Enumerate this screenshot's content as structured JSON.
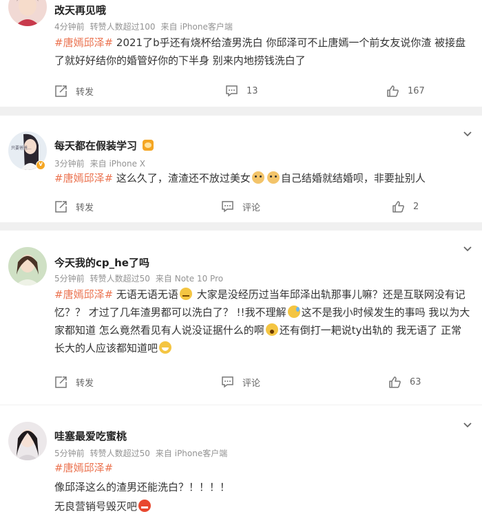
{
  "posts": [
    {
      "name": "改天再见哦",
      "time": "4分钟前",
      "reposts_note": "转赞人数超过100",
      "source": "来自 iPhone客户端",
      "tag": "#唐嫣邱泽#",
      "body": " 2021了b乎还有烧杯给渣男洗白 你邱泽可不止唐嫣一个前女友说你渣 被接盘了就好好结你的婚管好你的下半身 别来内地捞钱洗白了",
      "repost_label": "转发",
      "comment_label": "13",
      "like_label": "167"
    },
    {
      "name": "每天都在假装学习",
      "time": "3分钟前",
      "source": "来自 iPhone X",
      "tag": "#唐嫣邱泽#",
      "body_1": " 这么久了，渣渣还不放过美女",
      "body_2": "自己结婚就结婚呗，非要扯别人",
      "repost_label": "转发",
      "comment_label": "评论",
      "like_label": "2",
      "avatar_text": "只要爸爸..."
    },
    {
      "name": "今天我的cp_he了吗",
      "time": "5分钟前",
      "reposts_note": "转赞人数超过50",
      "source": "来自 Note 10 Pro",
      "tag": "#唐嫣邱泽#",
      "body_1": " 无语无语无语",
      "body_2": " 大家是没经历过当年邱泽出轨那事儿嘛？还是互联网没有记忆？？ 才过了几年渣男都可以洗白了？ !!我不理解",
      "body_3": "这不是我小时候发生的事吗 我以为大家都知道 怎么竟然看见有人说没证据什么的啊",
      "body_4": "还有倒打一耙说ty出轨的 我无语了 正常长大的人应该都知道吧",
      "repost_label": "转发",
      "comment_label": "评论",
      "like_label": "63"
    },
    {
      "name": "哇塞最爱吃蜜桃",
      "time": "5分钟前",
      "reposts_note": "转赞人数超过50",
      "source": "来自 iPhone客户端",
      "tag": "#唐嫣邱泽#",
      "line_1": "像邱泽这么的渣男还能洗白？！！！！",
      "line_2": "无良营销号毁灭吧"
    }
  ],
  "colors": {
    "tag": "#eb7350",
    "meta": "#939393",
    "badge": "#f5a623"
  },
  "icons": [
    "repost-icon",
    "comment-icon",
    "like-icon",
    "chevron-down-icon",
    "vip-badge-icon"
  ]
}
